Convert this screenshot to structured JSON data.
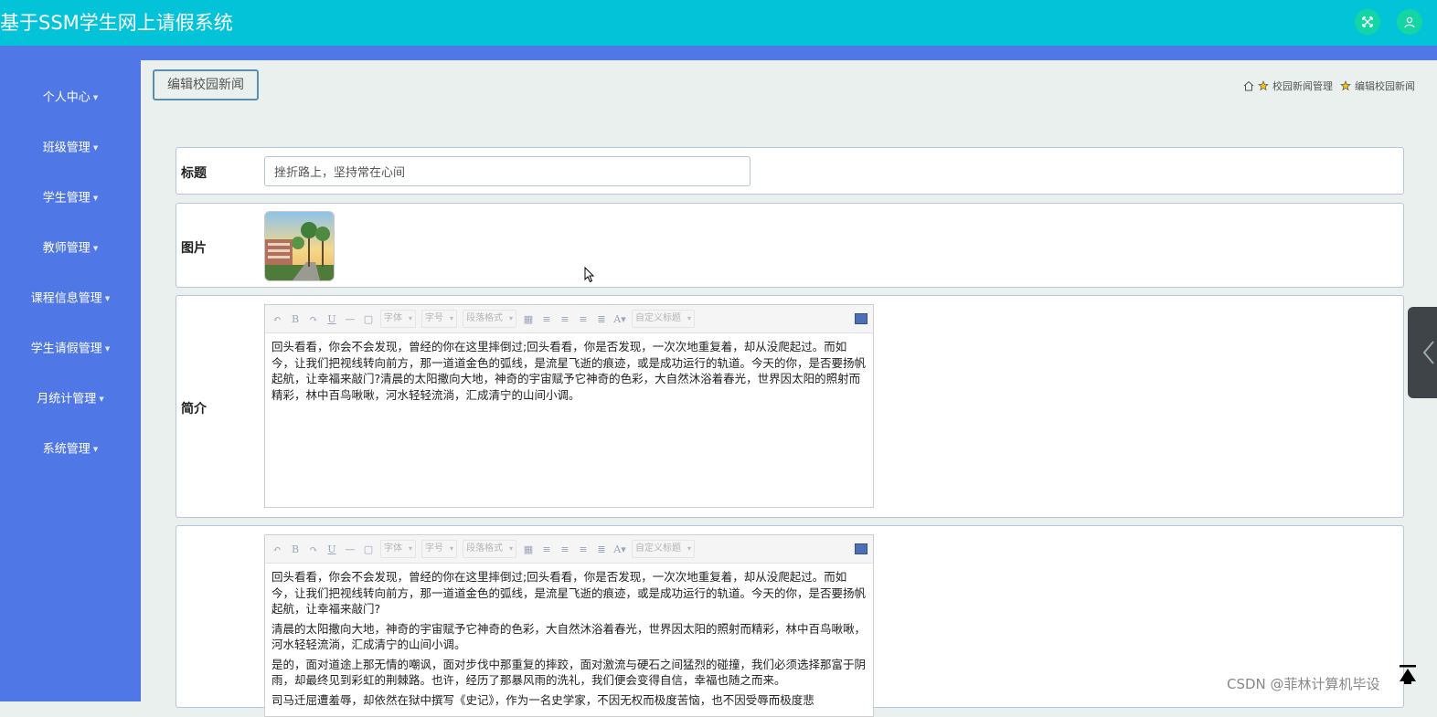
{
  "app": {
    "title": "基于SSM学生网上请假系统"
  },
  "header": {
    "icons": [
      "fullscreen-icon",
      "user-icon"
    ]
  },
  "sidebar": {
    "items": [
      {
        "label": "个人中心"
      },
      {
        "label": "班级管理"
      },
      {
        "label": "学生管理"
      },
      {
        "label": "教师管理"
      },
      {
        "label": "课程信息管理"
      },
      {
        "label": "学生请假管理"
      },
      {
        "label": "月统计管理"
      },
      {
        "label": "系统管理"
      }
    ]
  },
  "page": {
    "button_label": "编辑校园新闻",
    "breadcrumb": [
      "校园新闻管理",
      "编辑校园新闻"
    ]
  },
  "form": {
    "title_label": "标题",
    "title_value": "挫折路上，坚持常在心间",
    "image_label": "图片",
    "intro_label": "简介",
    "intro_text": "回头看看，你会不会发现，曾经的你在这里摔倒过;回头看看，你是否发现，一次次地重复着，却从没爬起过。而如今，让我们把视线转向前方，那一道道金色的弧线，是流星飞逝的痕迹，或是成功运行的轨道。今天的你，是否要扬帆起航，让幸福来敲门?清晨的太阳撒向大地，神奇的宇宙赋予它神奇的色彩，大自然沐浴着春光，世界因太阳的照射而精彩，林中百鸟啾啾，河水轻轻流淌，汇成清宁的山间小调。",
    "content_paragraphs": [
      "回头看看，你会不会发现，曾经的你在这里摔倒过;回头看看，你是否发现，一次次地重复着，却从没爬起过。而如今，让我们把视线转向前方，那一道道金色的弧线，是流星飞逝的痕迹，或是成功运行的轨道。今天的你，是否要扬帆起航，让幸福来敲门?",
      "清晨的太阳撒向大地，神奇的宇宙赋予它神奇的色彩，大自然沐浴着春光，世界因太阳的照射而精彩，林中百鸟啾啾，河水轻轻流淌，汇成清宁的山间小调。",
      "是的，面对道途上那无情的嘲讽，面对步伐中那重复的摔跤，面对激流与硬石之间猛烈的碰撞，我们必须选择那富于阴雨，却最终见到彩虹的荆棘路。也许，经历了那暴风雨的洗礼，我们便会变得自信，幸福也随之而来。",
      "司马迁屈遭羞辱，却依然在狱中撰写《史记》，作为一名史学家，不因无权而极度苦恼，也不因受辱而极度悲"
    ]
  },
  "editor": {
    "font_placeholder": "字体",
    "size_placeholder": "字号",
    "para_placeholder": "段落格式",
    "custom_placeholder": "自定义标题"
  },
  "watermark": "CSDN @菲林计算机毕设",
  "colors": {
    "topbar": "#03c3d8",
    "sidebar": "#5077e6",
    "page_bg": "#eaf0ee",
    "top_button": "#13d6a4"
  }
}
